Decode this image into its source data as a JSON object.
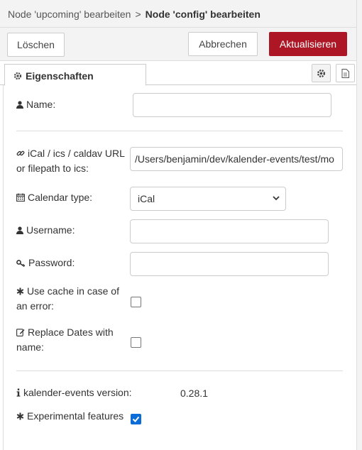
{
  "header": {
    "parent": "Node 'upcoming' bearbeiten",
    "separator": ">",
    "current": "Node 'config' bearbeiten"
  },
  "toolbar": {
    "delete_label": "Löschen",
    "cancel_label": "Abbrechen",
    "update_label": "Aktualisieren"
  },
  "tabs": {
    "properties_label": "Eigenschaften"
  },
  "form": {
    "name": {
      "label": "Name:",
      "value": ""
    },
    "url": {
      "label_line1": "iCal / ics / caldav URL",
      "label_line2": "or filepath to ics:",
      "value": "/Users/benjamin/dev/kalender-events/test/mo"
    },
    "calendar_type": {
      "label": "Calendar type:",
      "selected": "iCal"
    },
    "username": {
      "label": "Username:",
      "value": ""
    },
    "password": {
      "label": "Password:",
      "value": ""
    },
    "use_cache": {
      "label_line1": "Use cache in case of",
      "label_line2": "an error:",
      "checked": false
    },
    "replace_dates": {
      "label_line1": "Replace Dates with",
      "label_line2": "name:",
      "checked": false
    },
    "version": {
      "label": "kalender-events version:",
      "value": "0.28.1"
    },
    "experimental": {
      "label": "Experimental features",
      "checked": true
    }
  },
  "colors": {
    "primary_button": "#ad1625",
    "checkbox_checked": "#0a6cd6"
  }
}
